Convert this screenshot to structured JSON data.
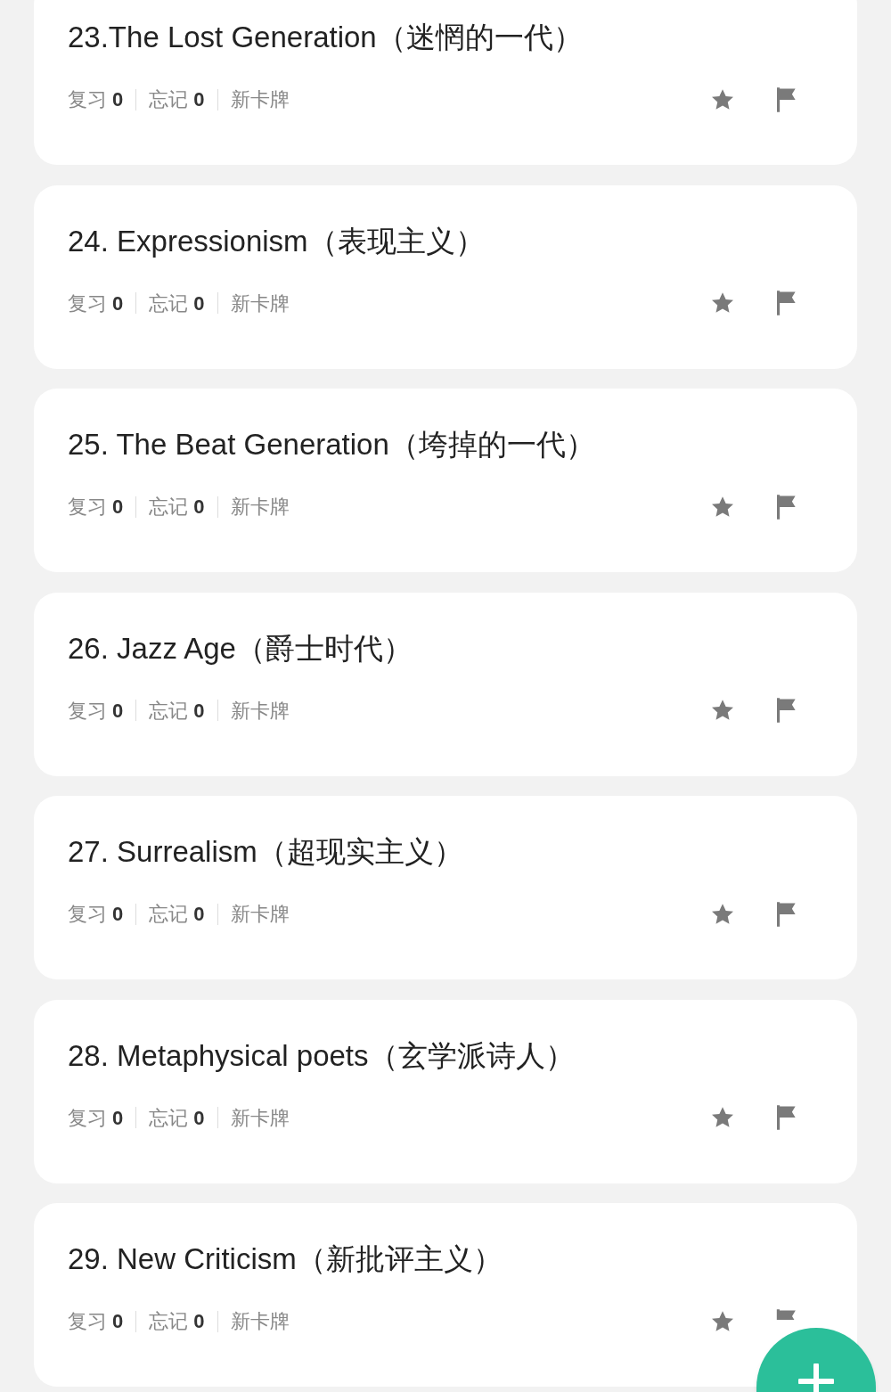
{
  "cards": [
    {
      "title": "23.The Lost Generation（迷惘的一代）",
      "stats": [
        {
          "label": "复习",
          "value": "0"
        },
        {
          "label": "忘记",
          "value": "0"
        }
      ],
      "tag": "新卡牌"
    },
    {
      "title": "24. Expressionism（表现主义）",
      "stats": [
        {
          "label": "复习",
          "value": "0"
        },
        {
          "label": "忘记",
          "value": "0"
        }
      ],
      "tag": "新卡牌"
    },
    {
      "title": "25. The Beat Generation（垮掉的一代）",
      "stats": [
        {
          "label": "复习",
          "value": "0"
        },
        {
          "label": "忘记",
          "value": "0"
        }
      ],
      "tag": "新卡牌"
    },
    {
      "title": "26. Jazz Age（爵士时代）",
      "stats": [
        {
          "label": "复习",
          "value": "0"
        },
        {
          "label": "忘记",
          "value": "0"
        }
      ],
      "tag": "新卡牌"
    },
    {
      "title": "27. Surrealism（超现实主义）",
      "stats": [
        {
          "label": "复习",
          "value": "0"
        },
        {
          "label": "忘记",
          "value": "0"
        }
      ],
      "tag": "新卡牌"
    },
    {
      "title": "28. Metaphysical poets（玄学派诗人）",
      "stats": [
        {
          "label": "复习",
          "value": "0"
        },
        {
          "label": "忘记",
          "value": "0"
        }
      ],
      "tag": "新卡牌"
    },
    {
      "title": "29. New Criticism（新批评主义）",
      "stats": [
        {
          "label": "复习",
          "value": "0"
        },
        {
          "label": "忘记",
          "value": "0"
        }
      ],
      "tag": "新卡牌"
    }
  ]
}
